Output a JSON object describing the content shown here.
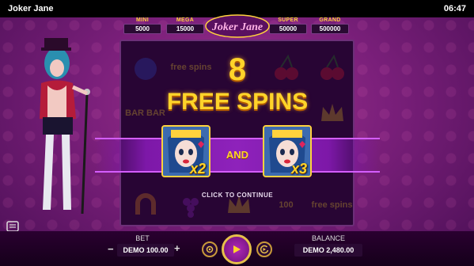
{
  "app": {
    "title": "Joker Jane",
    "clock": "06:47"
  },
  "jackpots": [
    {
      "name": "MINI",
      "value": "5000"
    },
    {
      "name": "MEGA",
      "value": "15000"
    },
    {
      "name": "SUPER",
      "value": "50000"
    },
    {
      "name": "GRAND",
      "value": "500000"
    }
  ],
  "logo": {
    "text": "Joker Jane"
  },
  "popup": {
    "count": "8",
    "label": "FREE SPINS",
    "connector": "AND",
    "multiplier_left": "x2",
    "multiplier_right": "x3",
    "prompt": "CLICK TO CONTINUE"
  },
  "reel_symbols": [
    "plum",
    "free spins",
    "cherry",
    "cherry",
    "BAR BAR",
    "crown",
    "horseshoe",
    "grapes",
    "crown",
    "100",
    "free spins"
  ],
  "controls": {
    "bet_label": "BET",
    "bet_value": "DEMO 100.00",
    "minus": "−",
    "plus": "+",
    "balance_label": "BALANCE",
    "balance_value": "DEMO 2,480.00"
  },
  "icons": {
    "paytable": "paytable-icon",
    "menu": "hamburger-menu-icon",
    "settings": "gear-icon",
    "play": "play-icon",
    "autoplay": "autoplay-icon"
  },
  "colors": {
    "gold": "#ffd42a",
    "purple": "#8e22bb",
    "background": "#7a1f7a"
  }
}
